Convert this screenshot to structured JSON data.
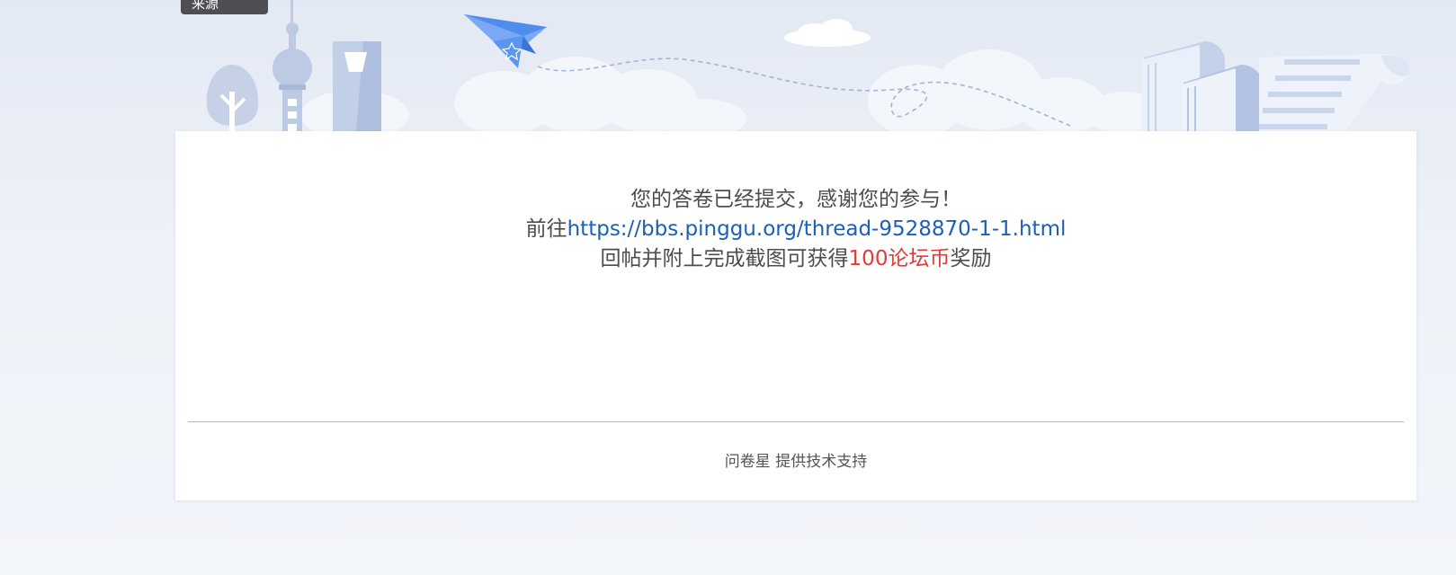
{
  "top_tab": {
    "label": "来源"
  },
  "message": {
    "line1": "您的答卷已经提交，感谢您的参与！",
    "line2_prefix": "前往",
    "line2_link": "https://bbs.pinggu.org/thread-9528870-1-1.html",
    "line3_prefix": "回帖并附上完成截图可获得",
    "line3_highlight": "100论坛币",
    "line3_suffix": "奖励"
  },
  "footer": {
    "brand": "问卷星",
    "support": "提供技术支持"
  },
  "icons": {
    "paper_plane": "paper-plane-icon",
    "tv_tower": "tv-tower-icon",
    "skyscraper": "skyscraper-icon",
    "tree": "tree-icon",
    "books": "books-icon",
    "paper_sheet": "paper-sheet-icon",
    "cloud": "cloud-icon"
  },
  "colors": {
    "link": "#1d5fb6",
    "highlight": "#e53935",
    "text": "#4d4d4d",
    "plane": "#4f8cf0"
  }
}
